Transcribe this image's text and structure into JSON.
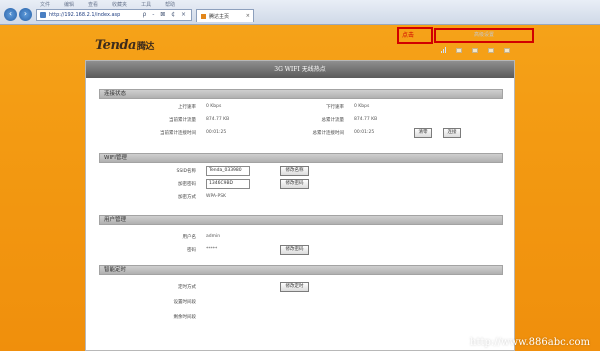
{
  "browser": {
    "menu": [
      "文件",
      "编辑",
      "查看",
      "收藏夹",
      "工具",
      "帮助"
    ],
    "address": "http://192.168.2.1/index.asp",
    "address_tools": "ρ - ⊠ ¢ ×",
    "tab_title": "腾达主页"
  },
  "header": {
    "logo": "Tenda",
    "logo_cn": "腾达",
    "click_label": "点击",
    "advanced_label": "高级设置"
  },
  "panel": {
    "title": "3G WIFI 无线热点",
    "connection": {
      "heading": "连接状态",
      "up_rate_label": "上行速率",
      "up_rate_value": "0 Kbps",
      "down_rate_label": "下行速率",
      "down_rate_value": "0 Kbps",
      "cur_traffic_label": "当前累计流量",
      "cur_traffic_value": "874.77 KB",
      "total_traffic_label": "总累计流量",
      "total_traffic_value": "874.77 KB",
      "cur_time_label": "当前累计连接时间",
      "cur_time_value": "00:01:25",
      "total_time_label": "总累计连接时间",
      "total_time_value": "00:01:25",
      "clear_btn": "清零",
      "connect_btn": "连接"
    },
    "wifi": {
      "heading": "WIFI管理",
      "ssid_label": "SSID名称",
      "ssid_value": "Tenda_033980",
      "ssid_btn": "修改名称",
      "key_label": "加密密码",
      "key_value": "1346C9BD",
      "key_btn": "修改密码",
      "mode_label": "加密方式",
      "mode_value": "WPA-PSK"
    },
    "user": {
      "heading": "用户管理",
      "name_label": "用户名",
      "name_value": "admin",
      "pwd_label": "密码",
      "pwd_value": "*****",
      "pwd_btn": "修改密码"
    },
    "schedule": {
      "heading": "智能定时",
      "mode_label": "定时方式",
      "mode_btn": "修改定时",
      "period_label": "设置时间段",
      "remaining_label": "剩余时间段"
    }
  },
  "watermark": "http://www.886abc.com"
}
